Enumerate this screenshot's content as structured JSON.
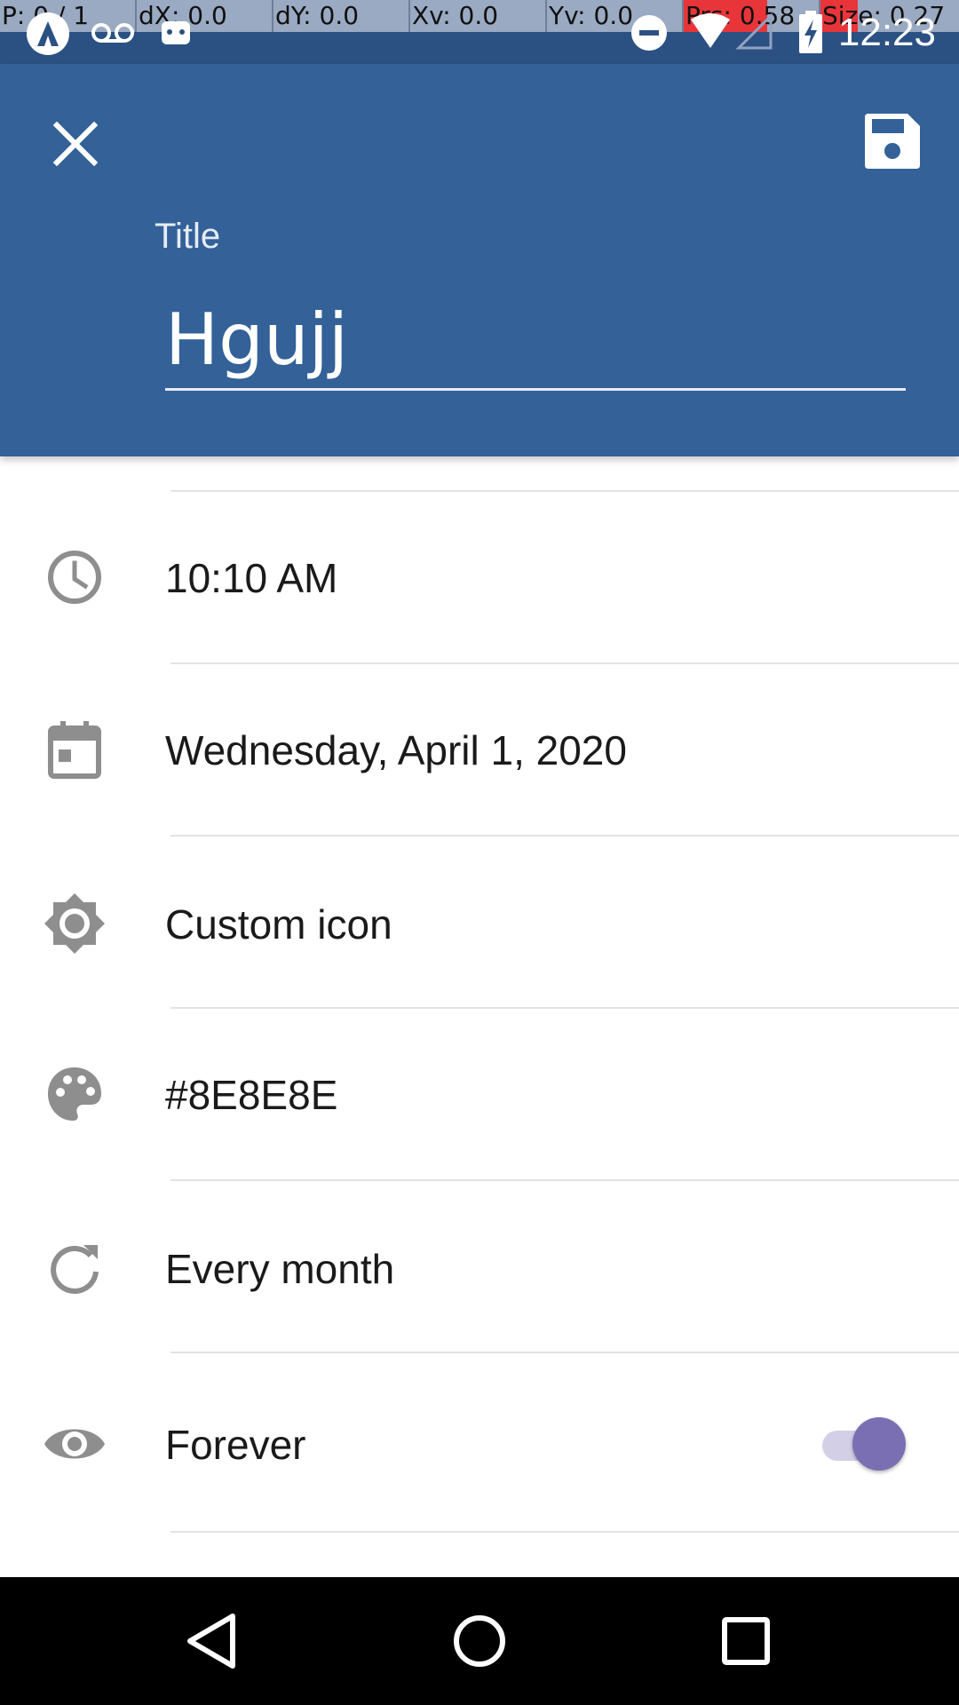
{
  "status_bar": {
    "debug": {
      "p": "P: 0 / 1",
      "dx": "dX: 0.0",
      "dy": "dY: 0.0",
      "xv": "Xv: 0.0",
      "yv": "Yv: 0.0",
      "prs": "Prs: 0.58",
      "size": "Size: 0.27"
    },
    "time": "12:23",
    "icons": [
      "app-icon",
      "voicemail-icon",
      "android-icon",
      "do-not-disturb-icon",
      "wifi-icon",
      "signal-icon",
      "battery-charging-icon"
    ]
  },
  "header": {
    "close_icon": "close-icon",
    "save_icon": "save-icon",
    "title_label": "Title",
    "title_value": "Hgujj",
    "background": "#336198"
  },
  "rows": [
    {
      "icon": "clock-icon",
      "label": "10:10 AM"
    },
    {
      "icon": "calendar-icon",
      "label": "Wednesday, April 1, 2020"
    },
    {
      "icon": "brightness-icon",
      "label": "Custom icon"
    },
    {
      "icon": "palette-icon",
      "label": "#8E8E8E"
    },
    {
      "icon": "repeat-icon",
      "label": "Every month"
    },
    {
      "icon": "eye-icon",
      "label": "Forever",
      "toggle_on": true
    }
  ],
  "colors": {
    "accent": "#7b6fb4",
    "icon_gray": "#8e8e8e"
  },
  "nav": {
    "icons": [
      "back-icon",
      "home-icon",
      "recents-icon"
    ]
  }
}
